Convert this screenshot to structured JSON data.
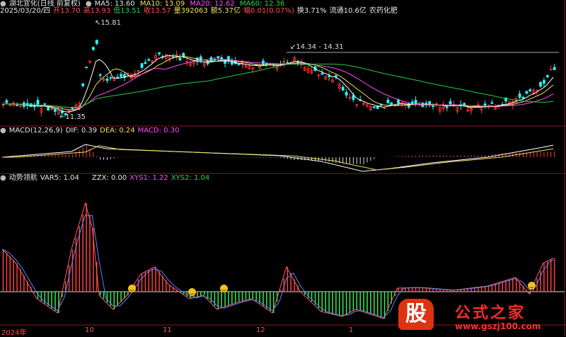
{
  "header1": {
    "circle_icon": "circle-icon",
    "title": "湖北宜化(日线 前复权)",
    "ma5": "MA5: 13.60",
    "ma10": "MA10: 13.09",
    "ma20": "MA20: 12.62",
    "ma60": "MA60: 12.36"
  },
  "header2": {
    "date": "2025/03/20/四",
    "open": "开13.70",
    "high": "高13.93",
    "low": "低13.51",
    "close": "收13.57",
    "vol": "量392063",
    "amt": "额5.37亿",
    "chg": "幅0.01(0.07%)",
    "turnover": "换3.71%",
    "float": "流通10.6亿",
    "industry": "农药化肥"
  },
  "macd_header": {
    "name": "MACD(12,26,9)",
    "dif": "DIF: 0.39",
    "dea": "DEA: 0.24",
    "macd": "MACD: 0.30"
  },
  "ind_header": {
    "name": "动势领航",
    "var5": "VAR5: 1.04",
    "zzx": "ZZX: 0.00",
    "xys1": "XYS1: 1.22",
    "xys2": "XYS2: 1.04"
  },
  "annotations": {
    "high_label": "15.81",
    "low_label": "11.35",
    "range_label": "14.34 - 14.31"
  },
  "axis": {
    "labels": [
      "2024年",
      "10",
      "11",
      "12",
      "1"
    ]
  },
  "logo": {
    "gu": "股",
    "text": "公式之家",
    "url": "www.gszj100.com"
  },
  "colors": {
    "up": "#ff3333",
    "down": "#22ffff",
    "ma5": "#ffffff",
    "ma10": "#f0e060",
    "ma20": "#ff4cff",
    "ma60": "#22cc44",
    "hist_up": "#ff4040",
    "hist_dn": "#33ee55"
  }
}
